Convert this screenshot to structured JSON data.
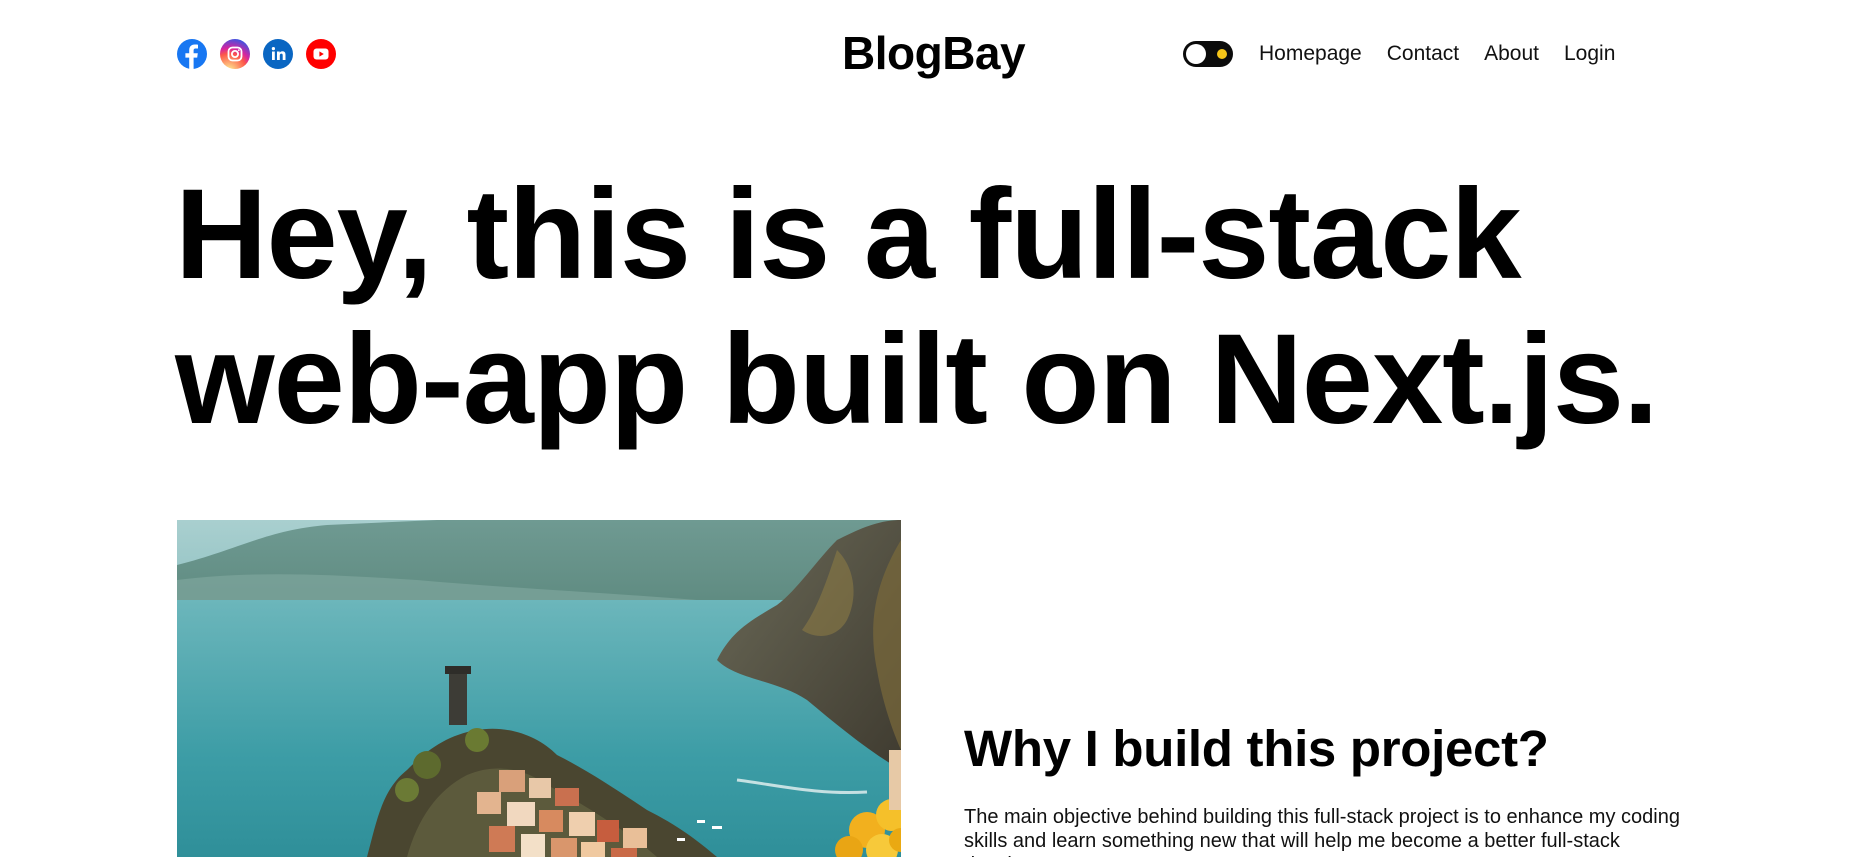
{
  "header": {
    "logo": "BlogBay",
    "socials": [
      {
        "name": "facebook-icon",
        "color": "#1877f2"
      },
      {
        "name": "instagram-icon",
        "color": "#d6249f"
      },
      {
        "name": "linkedin-icon",
        "color": "#0a66c2"
      },
      {
        "name": "youtube-icon",
        "color": "#ff0000"
      }
    ],
    "theme_toggle": {
      "state": "dark",
      "sun_color": "#f5c518"
    },
    "nav": {
      "homepage": "Homepage",
      "contact": "Contact",
      "about": "About",
      "login": "Login"
    }
  },
  "hero": {
    "title_line1": "Hey, this is a full-stack",
    "title_line2": "web-app built on Next.js."
  },
  "featured": {
    "image_icon": "coastal-village-image",
    "heading": "Why I build this project?",
    "text": "The main objective behind building this full-stack project is to enhance my coding skills and learn something new that will help me become a better full-stack developer."
  }
}
